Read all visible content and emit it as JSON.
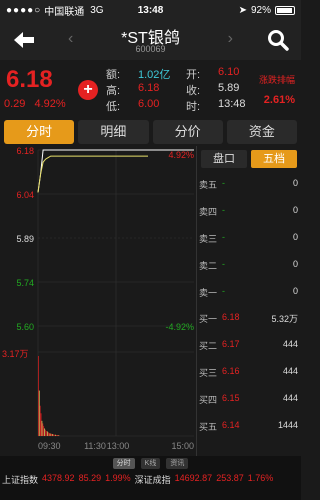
{
  "status": {
    "carrier": "中国联通",
    "network": "3G",
    "time": "13:48",
    "battery": "92%",
    "battery_level": 0.92
  },
  "nav": {
    "title": "*ST银鸽",
    "code": "600069"
  },
  "quote": {
    "price": "6.18",
    "change": "0.29",
    "change_pct": "4.92%",
    "amount_label": "额:",
    "amount": "1.02亿",
    "high_label": "高:",
    "high": "6.18",
    "low_label": "低:",
    "low": "6.00",
    "open_label": "开:",
    "open": "6.10",
    "close_label": "收:",
    "prev_close": "5.89",
    "time_label": "时:",
    "last_time": "13:48",
    "limit_label": "涨跌排幅",
    "limit_value": "2.61%"
  },
  "tabs": [
    "分时",
    "明细",
    "分价",
    "资金"
  ],
  "chart_data": {
    "type": "line",
    "y_ticks": [
      "6.18",
      "6.04",
      "5.89",
      "5.74",
      "5.60"
    ],
    "y_ticks_right": [
      "4.92%",
      "-4.92%"
    ],
    "x_ticks": [
      "09:30",
      "11:30",
      "13:00",
      "15:00"
    ],
    "ylim": [
      5.6,
      6.18
    ],
    "prev_close": 5.89,
    "price_series": [
      6.04,
      6.1,
      6.18,
      6.18,
      6.18,
      6.18,
      6.18,
      6.18,
      6.18,
      6.18,
      6.18,
      6.18
    ],
    "avg_series": [
      6.04,
      6.1,
      6.14,
      6.15,
      6.155,
      6.16,
      6.16,
      6.16,
      6.16,
      6.16,
      6.16,
      6.16
    ],
    "volume_max_label": "3.17万",
    "volume_series": [
      3.17,
      1.8,
      1.2,
      0.9,
      0.6,
      0.5,
      0.4,
      0.3,
      0.25,
      0.2,
      0.18,
      0.15,
      0.12,
      0.1,
      0.1,
      0.08,
      0.08,
      0.06,
      0.05,
      0.05,
      0.04,
      0.04,
      0.03,
      0.03
    ]
  },
  "side_tabs": [
    "盘口",
    "五档"
  ],
  "order_book": {
    "asks": [
      {
        "label": "卖五",
        "price": "-",
        "volume": "0"
      },
      {
        "label": "卖四",
        "price": "-",
        "volume": "0"
      },
      {
        "label": "卖三",
        "price": "-",
        "volume": "0"
      },
      {
        "label": "卖二",
        "price": "-",
        "volume": "0"
      },
      {
        "label": "卖一",
        "price": "-",
        "volume": "0"
      }
    ],
    "bids": [
      {
        "label": "买一",
        "price": "6.18",
        "volume": "5.32万"
      },
      {
        "label": "买二",
        "price": "6.17",
        "volume": "444"
      },
      {
        "label": "买三",
        "price": "6.16",
        "volume": "444"
      },
      {
        "label": "买四",
        "price": "6.15",
        "volume": "444"
      },
      {
        "label": "买五",
        "price": "6.14",
        "volume": "1444"
      }
    ]
  },
  "index_tabs": [
    "分时",
    "K线",
    "资讯"
  ],
  "indices": [
    {
      "name": "上证指数",
      "value": "4378.92",
      "change": "85.29",
      "pct": "1.99%"
    },
    {
      "name": "深证成指",
      "value": "14692.87",
      "change": "253.87",
      "pct": "1.76%"
    }
  ],
  "colors": {
    "up": "#e52222",
    "down": "#22aa22",
    "accent": "#e69a1a",
    "avg_line": "#e8e06a"
  }
}
